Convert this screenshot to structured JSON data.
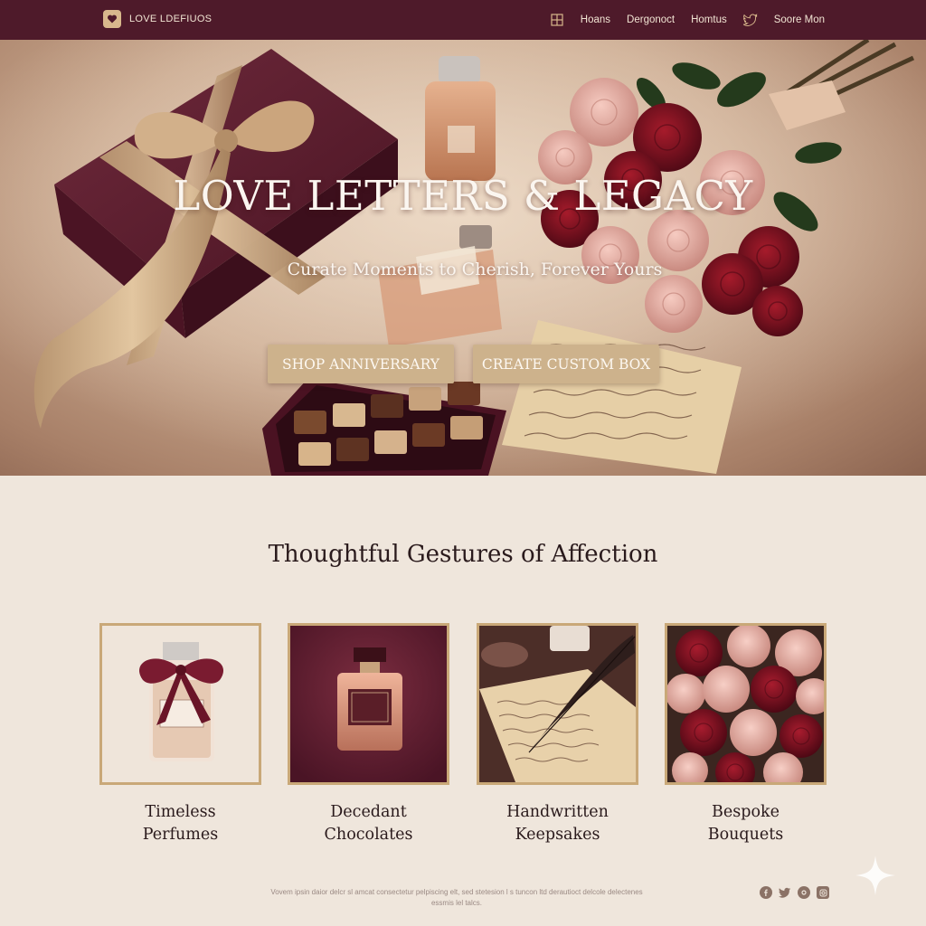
{
  "brand": {
    "name": "LOVE LDEFIUOS",
    "logo_icon": "heart-logo-icon"
  },
  "nav": {
    "items": [
      "Hoans",
      "Dergonoct",
      "Homtus"
    ],
    "grid_icon": "grid-icon",
    "bird_icon": "bird-icon",
    "account": "Soore Mon"
  },
  "hero": {
    "title": "LOVE LETTERS & LEGACY",
    "subtitle": "Curate Moments to Cherish, Forever Yours",
    "btn_shop": "SHOP ANNIVERSARY",
    "btn_create": "CREATE CUSTOM BOX"
  },
  "section": {
    "title": "Thoughtful Gestures of Affection",
    "cards": [
      {
        "label": "Timeless\nPerfumes",
        "image": "perfume-bow"
      },
      {
        "label": "Decedant\nChocolates",
        "image": "perfume-bottle"
      },
      {
        "label": "Handwritten\nKeepsakes",
        "image": "quill-letter"
      },
      {
        "label": "Bespoke\nBouquets",
        "image": "roses-bouquet"
      }
    ]
  },
  "footer": {
    "text": "Vovem ipsin daior delcr sl amcat  consectetur pelpiscing elt,  sed stetesion l s tuncon ltd derautioct delcole delectenes essmis lel talcs."
  },
  "socials": [
    "facebook-icon",
    "twitter-icon",
    "pinterest-icon",
    "instagram-icon"
  ],
  "colors": {
    "nav_bg": "#4e1a2a",
    "gold": "#cdb28c",
    "page_bg": "#efe6dc",
    "burgundy": "#5e1b2c"
  }
}
